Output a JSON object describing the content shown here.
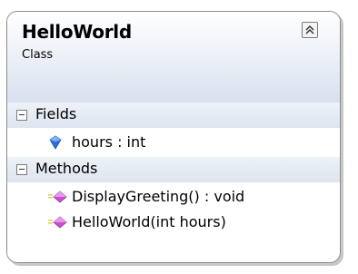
{
  "class_shape": {
    "name": "HelloWorld",
    "kind": "Class",
    "compartments": [
      {
        "label": "Fields",
        "members": [
          {
            "text": "hours : int",
            "icon": "field-icon"
          }
        ]
      },
      {
        "label": "Methods",
        "members": [
          {
            "text": "DisplayGreeting() : void",
            "icon": "method-icon"
          },
          {
            "text": "HelloWorld(int hours)",
            "icon": "method-icon"
          }
        ]
      }
    ]
  },
  "colors": {
    "border": "#8b8b8b",
    "header_gradient_bottom": "#d8e1ee",
    "compartment_header": "#dde5f0",
    "method_icon": "#c94fd3",
    "field_icon": "#2d6fd6"
  }
}
